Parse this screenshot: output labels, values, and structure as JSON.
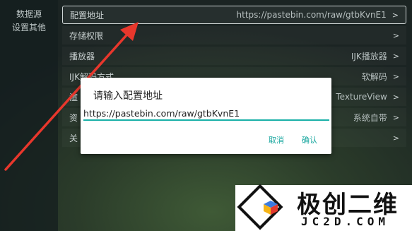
{
  "sidebar": {
    "items": [
      {
        "label": "数据源"
      },
      {
        "label": "设置其他"
      }
    ]
  },
  "settings": {
    "rows": [
      {
        "label": "配置地址",
        "value": "https://pastebin.com/raw/gtbKvnE1",
        "chevron": ">"
      },
      {
        "label": "存储权限",
        "value": "",
        "chevron": ">"
      },
      {
        "label": "播放器",
        "value": "IJK播放器",
        "chevron": ">"
      },
      {
        "label": "IJK解码方式",
        "value": "软解码",
        "chevron": ">"
      },
      {
        "label": "渲",
        "value": "TextureView",
        "chevron": ">"
      },
      {
        "label": "资",
        "value": "系统自带",
        "chevron": ">"
      },
      {
        "label": "关",
        "value": "",
        "chevron": ">"
      }
    ]
  },
  "dialog": {
    "title": "请输入配置地址",
    "input_value": "https://pastebin.com/raw/gtbKvnE1",
    "cancel_label": "取消",
    "confirm_label": "确认"
  },
  "watermark": {
    "name_cn": "极创二维",
    "domain": "JC2D.COM"
  },
  "colors": {
    "accent": "#19b0a8",
    "arrow": "#e8372c"
  }
}
